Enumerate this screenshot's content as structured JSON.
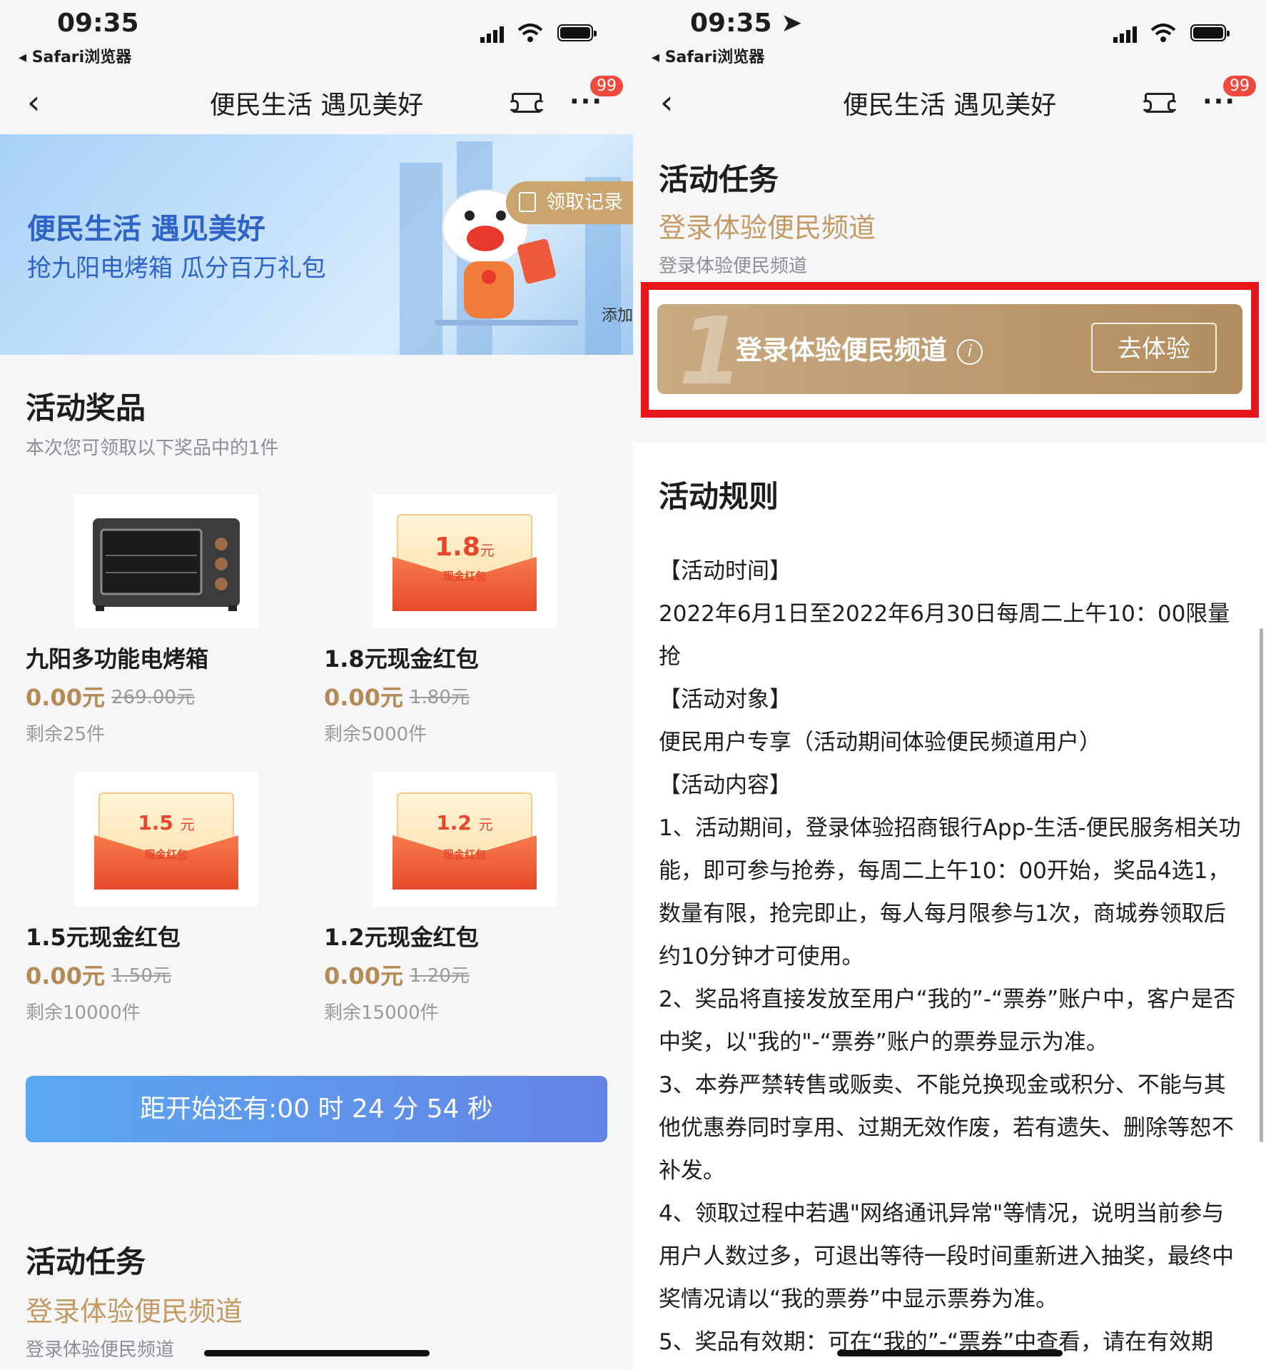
{
  "left": {
    "status": {
      "time": "09:35",
      "back_app": "◂ Safari浏览器"
    },
    "nav": {
      "title": "便民生活 遇见美好",
      "badge": "99"
    },
    "banner": {
      "title": "便民生活 遇见美好",
      "subtitle": "抢九阳电烤箱 瓜分百万礼包",
      "records": "领取记录",
      "add": "添加"
    },
    "prizes_section": {
      "title": "活动奖品",
      "subtitle": "本次您可领取以下奖品中的1件"
    },
    "prizes": [
      {
        "name": "九阳多功能电烤箱",
        "price": "0.00元",
        "original": "269.00元",
        "stock": "剩余25件",
        "image": "oven"
      },
      {
        "name": "1.8元现金红包",
        "price": "0.00元",
        "original": "1.80元",
        "stock": "剩余5000件",
        "env_amount": "1.8",
        "env_unit": "元",
        "env_label": "现金红包"
      },
      {
        "name": "1.5元现金红包",
        "price": "0.00元",
        "original": "1.50元",
        "stock": "剩余10000件",
        "env_amount": "1.5",
        "env_unit": "元",
        "env_label": "现金红包"
      },
      {
        "name": "1.2元现金红包",
        "price": "0.00元",
        "original": "1.20元",
        "stock": "剩余15000件",
        "env_amount": "1.2",
        "env_unit": "元",
        "env_label": "现金红包"
      }
    ],
    "countdown": "距开始还有:00 时 24 分 54 秒",
    "tasks": {
      "title": "活动任务",
      "task_name": "登录体验便民频道",
      "task_desc": "登录体验便民频道"
    }
  },
  "right": {
    "status": {
      "time": "09:35",
      "back_app": "◂ Safari浏览器"
    },
    "nav": {
      "title": "便民生活 遇见美好",
      "badge": "99"
    },
    "tasks": {
      "title": "活动任务",
      "task_name": "登录体验便民频道",
      "task_desc": "登录体验便民频道"
    },
    "task_card": {
      "number": "1",
      "title": "登录体验便民频道",
      "info": "i",
      "button": "去体验"
    },
    "rules": {
      "title": "活动规则",
      "lines": [
        "【活动时间】",
        "2022年6月1日至2022年6月30日每周二上午10：00限量抢",
        "【活动对象】",
        "便民用户专享（活动期间体验便民频道用户）",
        "【活动内容】",
        "1、活动期间，登录体验招商银行App-生活-便民服务相关功能，即可参与抢券，每周二上午10：00开始，奖品4选1，数量有限，抢完即止，每人每月限参与1次，商城券领取后约10分钟才可使用。",
        "2、奖品将直接发放至用户“我的”-“票券”账户中，客户是否中奖，以\"我的\"-“票券”账户的票券显示为准。",
        "3、本券严禁转售或贩卖、不能兑换现金或积分、不能与其他优惠券同时享用、过期无效作废，若有遗失、删除等恕不补发。",
        "4、领取过程中若遇\"网络通讯异常\"等情况，说明当前参与用户人数过多，可退出等待一段时间重新进入抽奖，最终中奖情况请以“我的票券”中显示票券为准。",
        "5、奖品有效期：可在“我的”-“票券”中查看，请在有效期"
      ]
    }
  }
}
